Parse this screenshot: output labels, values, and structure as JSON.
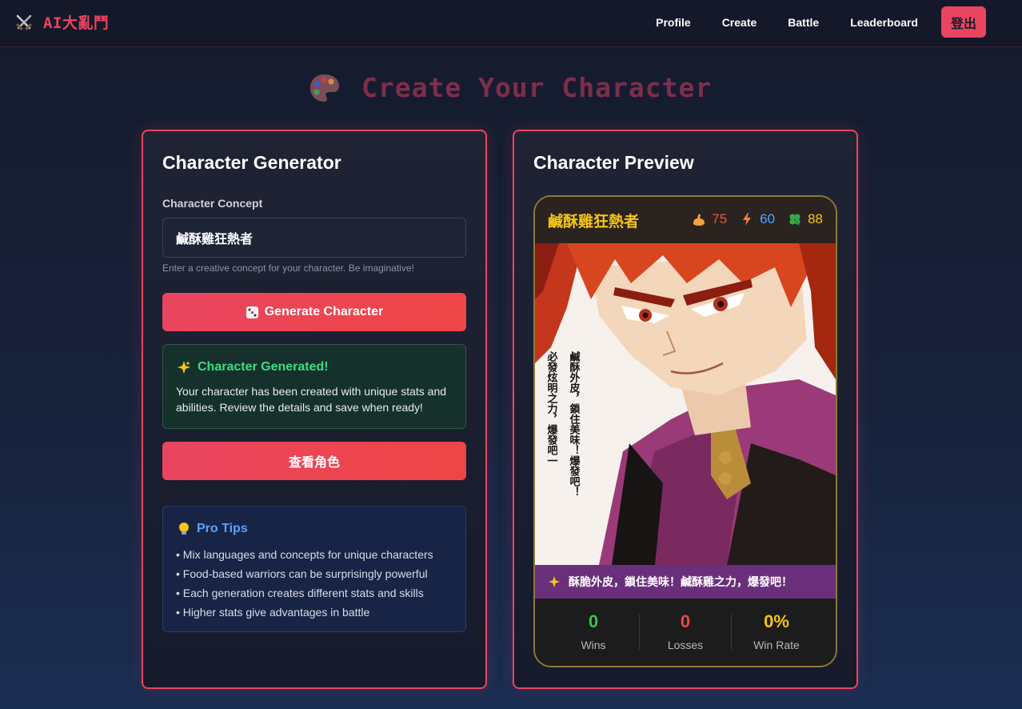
{
  "nav": {
    "brand": "AI大亂鬥",
    "links": [
      "Profile",
      "Create",
      "Battle",
      "Leaderboard"
    ],
    "logout": "登出",
    "brand_icon": "crossed-swords-icon"
  },
  "page": {
    "title": "Create Your Character",
    "title_icon": "palette-icon"
  },
  "generator": {
    "title": "Character Generator",
    "concept_label": "Character Concept",
    "concept_value": "鹹酥雞狂熱者",
    "concept_hint": "Enter a creative concept for your character. Be imaginative!",
    "generate_button": "Generate Character",
    "generate_icon": "dice-icon",
    "success_title": "Character Generated!",
    "success_text": "Your character has been created with unique stats and abilities. Review the details and save when ready!",
    "view_button": "查看角色",
    "tips_title": "Pro Tips",
    "tips": [
      "• Mix languages and concepts for unique characters",
      "• Food-based warriors can be surprisingly powerful",
      "• Each generation creates different stats and skills",
      "• Higher stats give advantages in battle"
    ]
  },
  "preview": {
    "title": "Character Preview",
    "character_name": "鹹酥雞狂熱者",
    "stats": {
      "strength": "75",
      "speed": "60",
      "luck": "88"
    },
    "portrait_caption_left": "必發炫明之力，爆發吧一",
    "portrait_caption_right": "鹹酥外皮，鎖住美味！爆發吧！",
    "quote": "酥脆外皮，鎖住美味！鹹酥雞之力，爆發吧！",
    "record": {
      "wins": "0",
      "wins_label": "Wins",
      "losses": "0",
      "losses_label": "Losses",
      "win_rate": "0%",
      "win_rate_label": "Win Rate"
    }
  },
  "colors": {
    "accent": "#e94560",
    "gold": "#f5c518",
    "success": "#3ddc84",
    "info": "#5aa2ff"
  }
}
